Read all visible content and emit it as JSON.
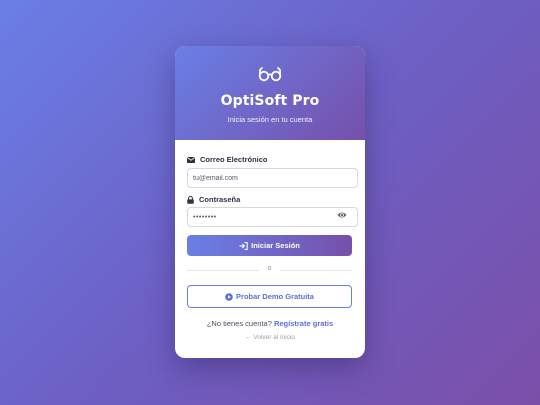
{
  "header": {
    "logo_icon": "glasses-icon",
    "brand": "OptiSoft Pro",
    "tagline": "Inicia sesión en tu cuenta"
  },
  "form": {
    "email": {
      "icon": "envelope-icon",
      "label": "Correo Electrónico",
      "placeholder": "tu@email.com"
    },
    "password": {
      "icon": "lock-icon",
      "label": "Contraseña",
      "value": "••••••••",
      "toggle_icon": "eye-icon"
    },
    "submit_label": "Iniciar Sesión",
    "submit_icon": "sign-in-icon"
  },
  "divider_text": "o",
  "demo": {
    "icon": "play-circle-icon",
    "label": "Probar Demo Gratuita"
  },
  "signup": {
    "prompt": "¿No tienes cuenta?",
    "link": "Regístrate gratis"
  },
  "back": {
    "label": "← Volver al inicio"
  },
  "colors": {
    "accent_start": "#6a7fe6",
    "accent_end": "#7650ab",
    "link": "#5c6fd8"
  }
}
